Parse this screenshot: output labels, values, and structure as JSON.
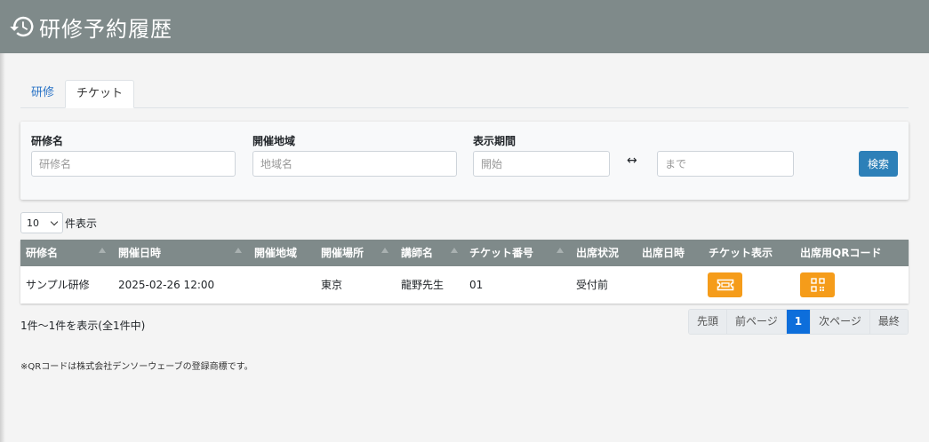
{
  "header": {
    "title": "研修予約履歴",
    "icon": "history-icon"
  },
  "tabs": [
    {
      "label": "研修"
    },
    {
      "label": "チケット"
    }
  ],
  "filter": {
    "name_label": "研修名",
    "name_placeholder": "研修名",
    "region_label": "開催地域",
    "region_placeholder": "地域名",
    "period_label": "表示期間",
    "start_placeholder": "開始",
    "range_symbol": "↔",
    "end_placeholder": "まで",
    "search_label": "検索"
  },
  "length": {
    "value": "10",
    "suffix": "件表示"
  },
  "table": {
    "columns": [
      "研修名",
      "開催日時",
      "開催地域",
      "開催場所",
      "講師名",
      "チケット番号",
      "出席状況",
      "出席日時",
      "チケット表示",
      "出席用QRコード"
    ],
    "rows": [
      {
        "name": "サンプル研修",
        "datetime": "2025-02-26 12:00",
        "region": "",
        "place": "東京",
        "lecturer": "龍野先生",
        "ticket_no": "01",
        "status": "受付前",
        "attend_time": ""
      }
    ]
  },
  "info": "1件～1件を表示(全1件中)",
  "pagination": {
    "first": "先頭",
    "prev": "前ページ",
    "current": "1",
    "next": "次ページ",
    "last": "最終"
  },
  "note": "※QRコードは株式会社デンソーウェーブの登録商標です。",
  "colors": {
    "header": "#7f8a8a",
    "accent": "#2d80b8",
    "button_orange": "#f59c1a",
    "active_page": "#0d6edb"
  }
}
